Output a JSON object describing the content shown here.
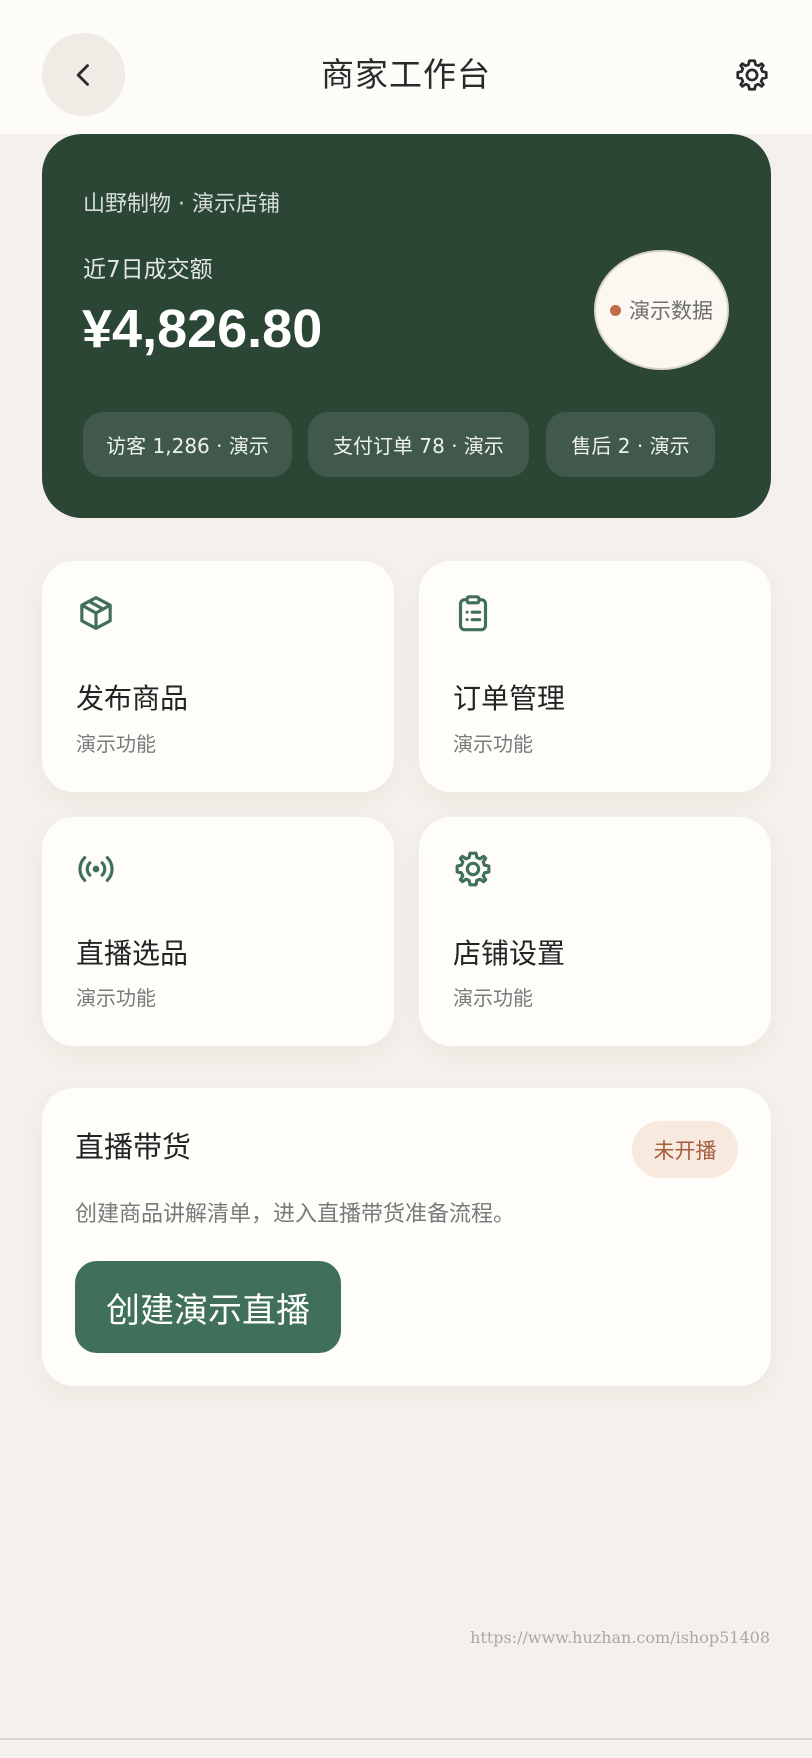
{
  "header": {
    "title": "商家工作台",
    "back_icon": "chevron-left-icon",
    "settings_icon": "gear-icon"
  },
  "hero": {
    "store_name": "山野制物 · 演示店铺",
    "sales_label": "近7日成交额",
    "sales_amount": "¥4,826.80",
    "demo_badge": "演示数据",
    "stats": [
      {
        "label": "访客 1,286 · 演示"
      },
      {
        "label": "支付订单 78 · 演示"
      },
      {
        "label": "售后 2 · 演示"
      }
    ],
    "colors": {
      "background": "#2c4636",
      "badge_dot": "#c36a48"
    }
  },
  "features": [
    {
      "title": "发布商品",
      "subtitle": "演示功能",
      "icon": "box-icon"
    },
    {
      "title": "订单管理",
      "subtitle": "演示功能",
      "icon": "clipboard-icon"
    },
    {
      "title": "直播选品",
      "subtitle": "演示功能",
      "icon": "broadcast-icon"
    },
    {
      "title": "店铺设置",
      "subtitle": "演示功能",
      "icon": "gear-icon"
    }
  ],
  "live": {
    "title": "直播带货",
    "status": "未开播",
    "description": "创建商品讲解清单，进入直播带货准备流程。",
    "button_label": "创建演示直播",
    "colors": {
      "button": "#41705a",
      "status_bg": "#f8e9de",
      "status_text": "#a35e3d"
    }
  },
  "watermark": "https://www.huzhan.com/ishop51408"
}
